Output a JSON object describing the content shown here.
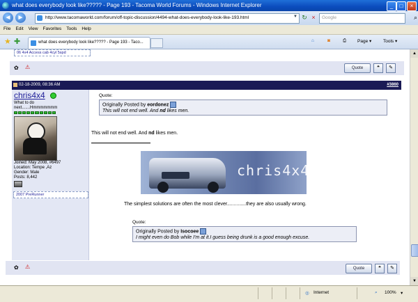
{
  "window": {
    "title": "what does everybody look like????? - Page 193 - Tacoma World Forums - Windows Internet Explorer",
    "controls": {
      "minimize": "_",
      "maximize": "□",
      "close": "×"
    }
  },
  "address_bar": {
    "url": "http://www.tacomaworld.com/forum/off-topic-discussion/4494-what-does-everybody-look-like-193.html",
    "search_placeholder": "Google"
  },
  "menu": [
    "File",
    "Edit",
    "View",
    "Favorites",
    "Tools",
    "Help"
  ],
  "tab": {
    "title": "what does everybody look like????? - Page 193 - Taco..."
  },
  "command_bar": {
    "page": "Page",
    "tools": "Tools"
  },
  "prev_post": {
    "userbox": "06 4x4 Access cab 4cyl 5spd",
    "quote_label": "Quote"
  },
  "post": {
    "date": "02-18-2009, 08:36 AM",
    "number": "#3860",
    "username": "chris4x4",
    "user_title": "What to do next.......Hmmmmmmm",
    "reputation_bars": 10,
    "stats": [
      "Joined: May 2008, #6497",
      "Location: Tempe ,Az",
      "Gender: Male",
      "Posts: 8,442"
    ],
    "userbox": "2007 PreRunner",
    "quote1": {
      "label": "Quote:",
      "by_prefix": "Originally Posted by",
      "author": "eordonez",
      "text_pre": "This will not end well. And",
      "text_bold": "nd",
      "text_post": "likes men."
    },
    "body_pre": "This will not end well. And",
    "body_bold": "nd",
    "body_post": "likes men.",
    "signature_banner": "chris4x4",
    "signature_text": "The simplest solutions are often the most clever..............they are also usually wrong.",
    "quote2": {
      "label": "Quote:",
      "by_prefix": "Originally Posted by",
      "author": "Isocoee",
      "text": "I might even do Bob while I'm at it.I guess being drunk is a good enough excuse."
    },
    "quote_label": "Quote"
  },
  "status_bar": {
    "zone": "Internet",
    "zoom": "100%"
  }
}
